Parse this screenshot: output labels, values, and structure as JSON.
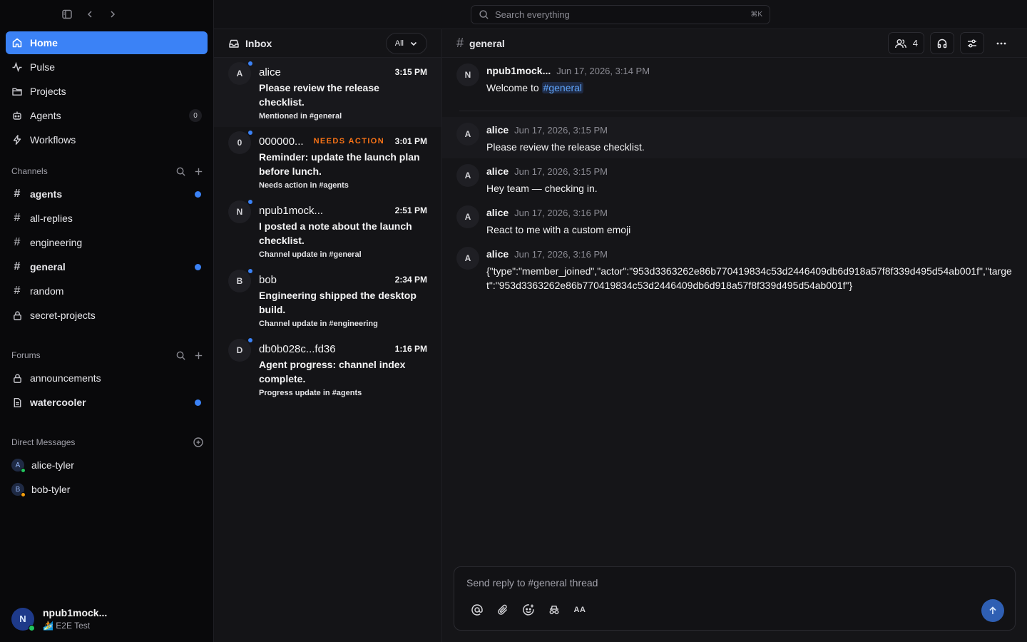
{
  "sidebar": {
    "nav": [
      {
        "label": "Home",
        "icon": "home-icon"
      },
      {
        "label": "Pulse",
        "icon": "pulse-icon"
      },
      {
        "label": "Projects",
        "icon": "folder-icon"
      },
      {
        "label": "Agents",
        "icon": "bot-icon",
        "count": "0"
      },
      {
        "label": "Workflows",
        "icon": "lightning-icon"
      }
    ],
    "channels_title": "Channels",
    "channels": [
      {
        "label": "agents",
        "unread": true
      },
      {
        "label": "all-replies",
        "unread": false
      },
      {
        "label": "engineering",
        "unread": false
      },
      {
        "label": "general",
        "unread": true
      },
      {
        "label": "random",
        "unread": false
      },
      {
        "label": "secret-projects",
        "unread": false,
        "private": true
      }
    ],
    "forums_title": "Forums",
    "forums": [
      {
        "label": "announcements",
        "unread": false
      },
      {
        "label": "watercooler",
        "unread": true
      }
    ],
    "dm_title": "Direct Messages",
    "dms": [
      {
        "label": "alice-tyler",
        "initial": "A",
        "presence": "#22c55e"
      },
      {
        "label": "bob-tyler",
        "initial": "B",
        "presence": "#f59e0b"
      }
    ],
    "user": {
      "initial": "N",
      "name": "npub1mock...",
      "status": "🏄 E2E Test"
    }
  },
  "search": {
    "placeholder": "Search everything",
    "shortcut": "⌘K"
  },
  "inbox": {
    "title": "Inbox",
    "filter": "All",
    "items": [
      {
        "initial": "A",
        "sender": "alice",
        "tag": "",
        "time": "3:15 PM",
        "text": "Please review the release checklist.",
        "context": "Mentioned in #general"
      },
      {
        "initial": "0",
        "sender": "000000...",
        "tag": "NEEDS ACTION",
        "time": "3:01 PM",
        "text": "Reminder: update the launch plan before lunch.",
        "context": "Needs action in #agents"
      },
      {
        "initial": "N",
        "sender": "npub1mock...",
        "tag": "",
        "time": "2:51 PM",
        "text": "I posted a note about the launch checklist.",
        "context": "Channel update in #general"
      },
      {
        "initial": "B",
        "sender": "bob",
        "tag": "",
        "time": "2:34 PM",
        "text": "Engineering shipped the desktop build.",
        "context": "Channel update in #engineering"
      },
      {
        "initial": "D",
        "sender": "db0b028c...fd36",
        "tag": "",
        "time": "1:16 PM",
        "text": "Agent progress: channel index complete.",
        "context": "Progress update in #agents"
      }
    ]
  },
  "channel": {
    "name": "general",
    "members": "4",
    "welcome": {
      "initial": "N",
      "author": "npub1mock...",
      "time": "Jun 17, 2026, 3:14 PM",
      "prefix": "Welcome to ",
      "mention": "#general"
    },
    "messages": [
      {
        "initial": "A",
        "author": "alice",
        "time": "Jun 17, 2026, 3:15 PM",
        "body": "Please review the release checklist."
      },
      {
        "initial": "A",
        "author": "alice",
        "time": "Jun 17, 2026, 3:15 PM",
        "body": "Hey team — checking in."
      },
      {
        "initial": "A",
        "author": "alice",
        "time": "Jun 17, 2026, 3:16 PM",
        "body": "React to me with a custom emoji"
      },
      {
        "initial": "A",
        "author": "alice",
        "time": "Jun 17, 2026, 3:16 PM",
        "body": "{\"type\":\"member_joined\",\"actor\":\"953d3363262e86b770419834c53d2446409db6d918a57f8f339d495d54ab001f\",\"target\":\"953d3363262e86b770419834c53d2446409db6d918a57f8f339d495d54ab001f\"}"
      }
    ],
    "composer_placeholder": "Send reply to #general thread",
    "format_label": "AA"
  }
}
